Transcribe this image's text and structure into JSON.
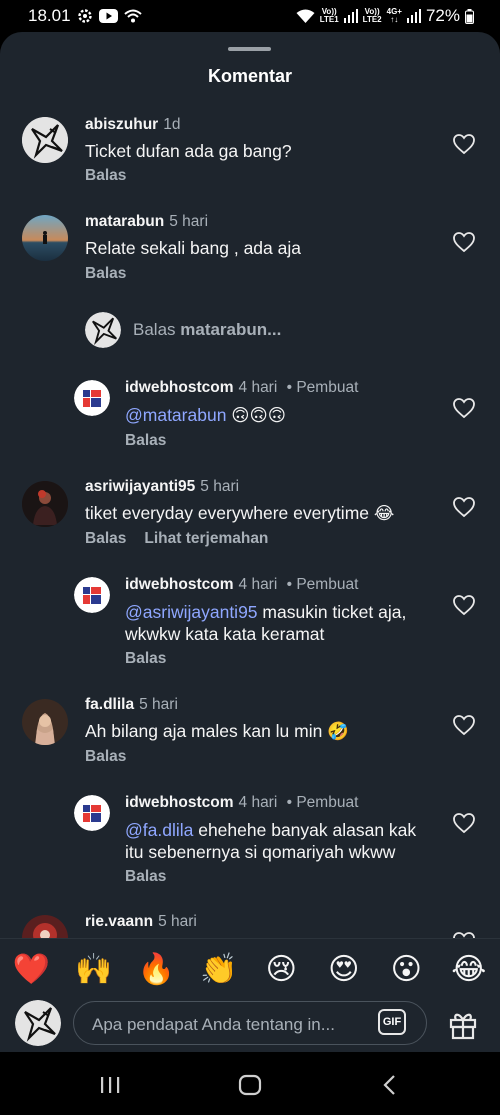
{
  "status_bar": {
    "time": "18.01",
    "sim1_tag_top": "Vo))",
    "sim1_tag_bottom": "LTE1",
    "sim2_tag_top": "Vo))",
    "sim2_tag_bottom": "LTE2",
    "network": "4G+",
    "battery": "72%",
    "icons": [
      "gear-icon",
      "youtube-icon",
      "wifi-icon",
      "signal-icon",
      "battery-icon"
    ]
  },
  "sheet": {
    "title": "Komentar"
  },
  "comments": [
    {
      "username": "abiszuhur",
      "time": "1d",
      "text": "Ticket dufan ada ga bang?",
      "actions": [
        "Balas"
      ]
    },
    {
      "username": "matarabun",
      "time": "5 hari",
      "text": "Relate sekali bang , ada aja",
      "actions": [
        "Balas"
      ],
      "reply_prompt": {
        "prefix": "Balas ",
        "target": "matarabun..."
      },
      "replies": [
        {
          "username": "idwebhostcom",
          "time": "4 hari",
          "author_badge": "• Pembuat",
          "mention": "@matarabun",
          "text": " 🙃🙃🙃",
          "actions": [
            "Balas"
          ]
        }
      ]
    },
    {
      "username": "asriwijayanti95",
      "time": "5 hari",
      "text": "tiket everyday everywhere everytime 😂",
      "actions": [
        "Balas",
        "Lihat terjemahan"
      ],
      "replies": [
        {
          "username": "idwebhostcom",
          "time": "4 hari",
          "author_badge": "• Pembuat",
          "mention": "@asriwijayanti95",
          "text": " masukin ticket aja, wkwkw kata kata keramat",
          "actions": [
            "Balas"
          ]
        }
      ]
    },
    {
      "username": "fa.dlila",
      "time": "5 hari",
      "text": "Ah bilang aja males kan lu min 🤣",
      "actions": [
        "Balas"
      ],
      "replies": [
        {
          "username": "idwebhostcom",
          "time": "4 hari",
          "author_badge": "• Pembuat",
          "mention": "@fa.dlila",
          "text": " ehehehe banyak alasan kak itu sebenernya si qomariyah wkww",
          "actions": [
            "Balas"
          ]
        }
      ]
    },
    {
      "username": "rie.vaann",
      "time": "5 hari"
    }
  ],
  "emoji_bar": [
    "❤️",
    "🙌",
    "🔥",
    "👏",
    "😢",
    "😍",
    "😮",
    "😂"
  ],
  "composer": {
    "placeholder": "Apa pendapat Anda tentang in...",
    "gif_label": "GIF",
    "icons": [
      "gift-icon"
    ]
  },
  "nav": {
    "icons": [
      "recent-apps-icon",
      "home-icon",
      "back-icon"
    ]
  },
  "colors": {
    "sheet_bg": "#1e252d",
    "mention": "#8fa7ff",
    "muted": "#a8b0b8",
    "brand_red": "#e53935",
    "brand_blue": "#2b3a8f"
  }
}
